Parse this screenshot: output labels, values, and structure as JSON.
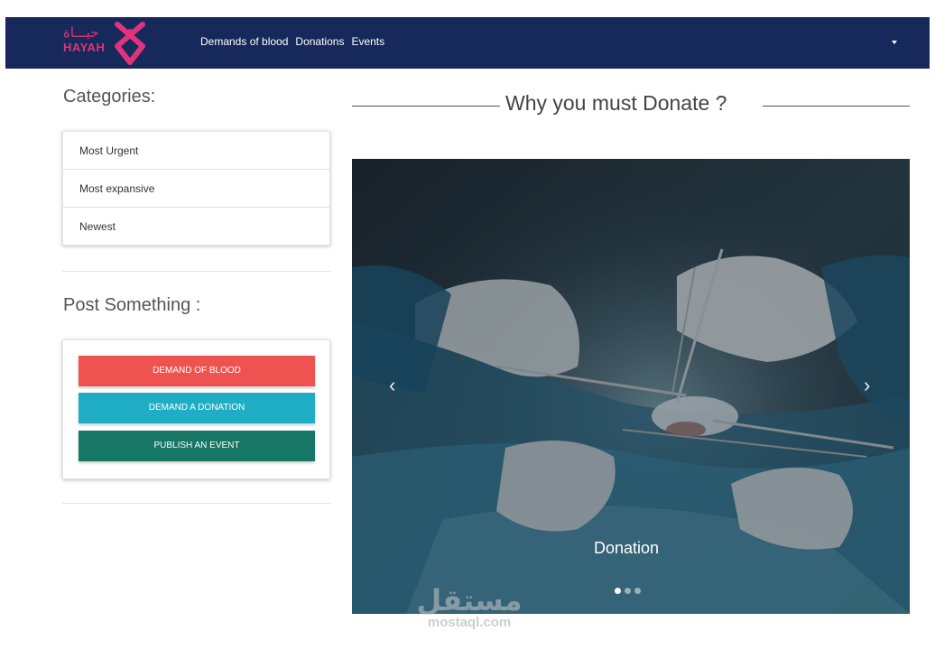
{
  "brand": {
    "arabic": "حيـــاة",
    "english": "HAYAH",
    "color": "#e0337b"
  },
  "nav": {
    "links": [
      "Demands of blood",
      "Donations",
      "Events"
    ],
    "background": "#16295a",
    "dropdown_icon": "caret-down-icon"
  },
  "sidebar": {
    "categories_title": "Categories:",
    "categories": [
      "Most Urgent",
      "Most expansive",
      "Newest"
    ],
    "post_title": "Post Something :",
    "buttons": [
      {
        "label": "DEMAND OF BLOOD",
        "color": "#ef5350"
      },
      {
        "label": "DEMAND A DONATION",
        "color": "#1fadc5"
      },
      {
        "label": "PUBLISH AN EVENT",
        "color": "#167766"
      }
    ]
  },
  "main": {
    "heading": "Why you must Donate ?",
    "carousel": {
      "caption": "Donation",
      "slide_count": 3,
      "active_index": 0,
      "prev_icon": "chevron-left-icon",
      "next_icon": "chevron-right-icon"
    }
  },
  "watermark": {
    "arabic": "مستقل",
    "english": "mostaql.com"
  }
}
